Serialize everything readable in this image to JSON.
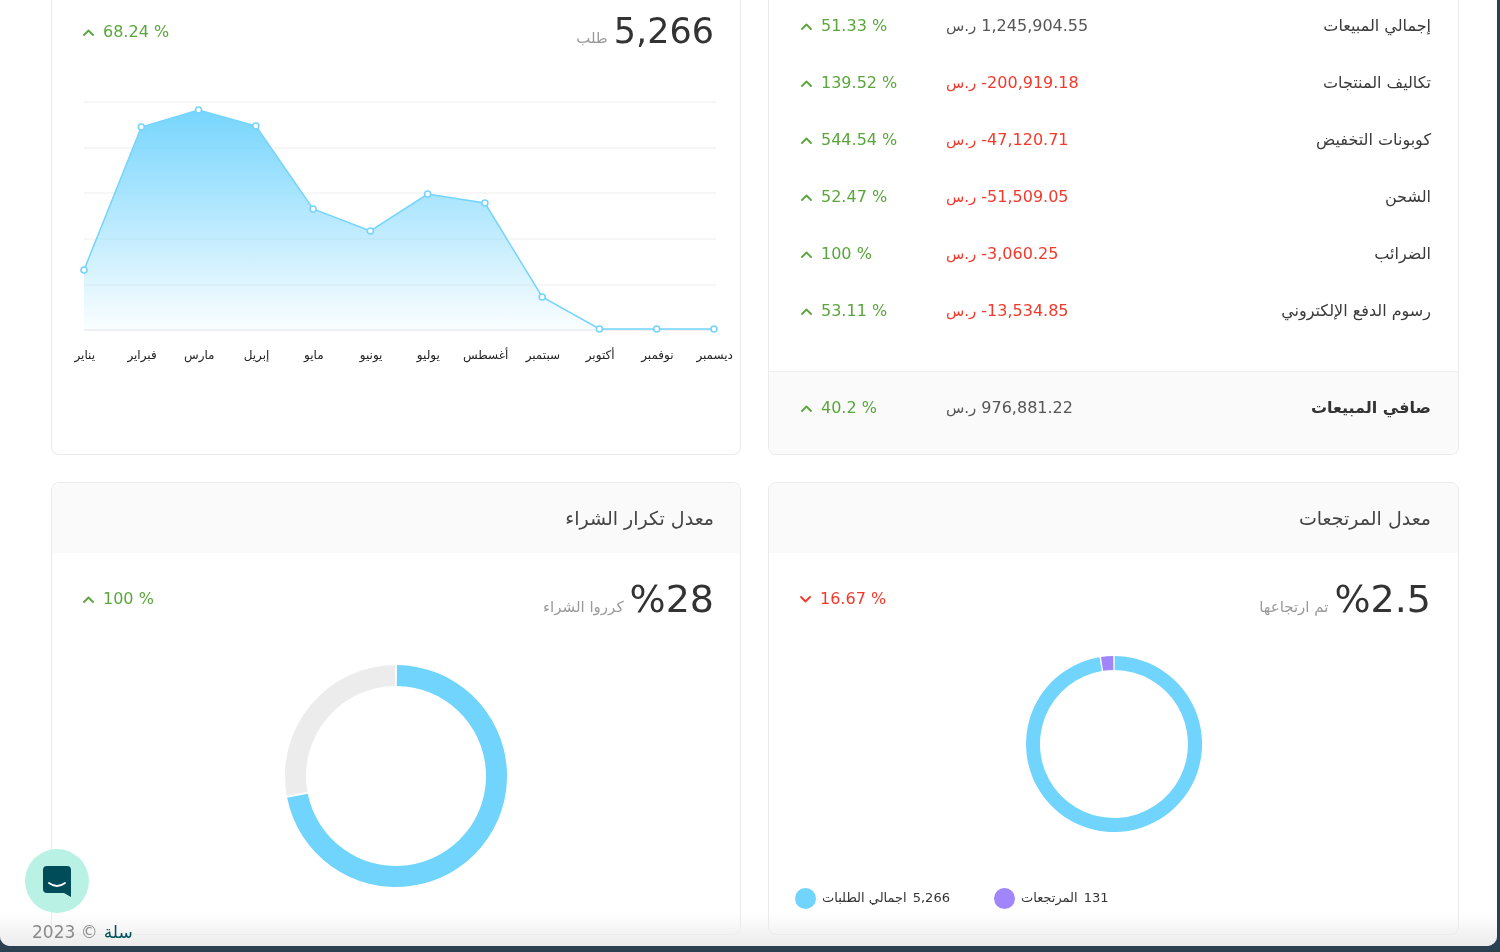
{
  "sales_summary": {
    "rows": [
      {
        "label": "إجمالي المبيعات",
        "amount": "1,245,904.55",
        "currency": "ر.س",
        "negative": false,
        "change": {
          "value": "51.33 %",
          "increase": true
        }
      },
      {
        "label": "تكاليف المنتجات",
        "amount": "-200,919.18",
        "currency": "ر.س",
        "negative": true,
        "change": {
          "value": "139.52 %",
          "increase": true
        }
      },
      {
        "label": "كوبونات التخفيض",
        "amount": "-47,120.71",
        "currency": "ر.س",
        "negative": true,
        "change": {
          "value": "544.54 %",
          "increase": true
        }
      },
      {
        "label": "الشحن",
        "amount": "-51,509.05",
        "currency": "ر.س",
        "negative": true,
        "change": {
          "value": "52.47 %",
          "increase": true
        }
      },
      {
        "label": "الضرائب",
        "amount": "-3,060.25",
        "currency": "ر.س",
        "negative": true,
        "change": {
          "value": "100 %",
          "increase": true
        }
      },
      {
        "label": "رسوم الدفع الإلكتروني",
        "amount": "-13,534.85",
        "currency": "ر.س",
        "negative": true,
        "change": {
          "value": "53.11 %",
          "increase": true
        }
      }
    ],
    "net": {
      "label": "صافي المبيعات",
      "amount": "976,881.22",
      "currency": "ر.س",
      "negative": false,
      "change": {
        "value": "40.2 %",
        "increase": true
      }
    }
  },
  "orders": {
    "value": "5,266",
    "unit": "طلب",
    "change": {
      "value": "68.24 %",
      "increase": true
    },
    "chart": {
      "x_labels": [
        "ديسمبر",
        "نوفمبر",
        "أكتوبر",
        "سبتمبر",
        "أغسطس",
        "يوليو",
        "يونيو",
        "مايو",
        "إبريل",
        "مارس",
        "فبراير",
        "يناير"
      ]
    }
  },
  "returns": {
    "title": "معدل المرتجعات",
    "value": "%2.5",
    "caption": "تم ارتجاعها",
    "change": {
      "value": "16.67 %",
      "increase": false
    },
    "chart_data": {
      "type": "donut",
      "values": [
        2.5,
        97.5
      ]
    },
    "legend": [
      {
        "label": "المرتجعات",
        "value": "131",
        "color": "#a185fb"
      },
      {
        "label": "اجمالي الطلبات",
        "value": "5,266",
        "color": "#70d4fd"
      }
    ]
  },
  "repeat_purchase": {
    "title": "معدل تكرار الشراء",
    "value": "%28",
    "caption": "كرروا الشراء",
    "change": {
      "value": "100 %",
      "increase": true
    },
    "chart_data": {
      "type": "donut",
      "values": [
        28,
        72
      ]
    }
  },
  "footer": {
    "brand": "سلة",
    "copyright": "© 2023"
  }
}
